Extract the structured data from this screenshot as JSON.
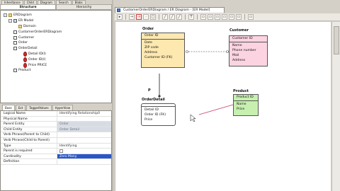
{
  "top_tabs": [
    "Inheritance",
    "Child",
    "Diagram",
    "Search",
    "Blobs"
  ],
  "panel_tabs": [
    "Structure",
    "Hierarchy"
  ],
  "tree": [
    {
      "indent": 0,
      "twist": "-",
      "icon": "folder",
      "label": "ERDiagram"
    },
    {
      "indent": 1,
      "twist": "-",
      "icon": "model",
      "label": "ER Model"
    },
    {
      "indent": 2,
      "twist": "none",
      "icon": "folder",
      "label": "Domain"
    },
    {
      "indent": 2,
      "twist": "none",
      "icon": "entity",
      "label": "CustomerOrderERDiagram"
    },
    {
      "indent": 2,
      "twist": "+",
      "icon": "entity",
      "label": "Customer"
    },
    {
      "indent": 2,
      "twist": "+",
      "icon": "entity",
      "label": "Order"
    },
    {
      "indent": 2,
      "twist": "-",
      "icon": "entity",
      "label": "OrderDetail"
    },
    {
      "indent": 3,
      "twist": "none",
      "icon": "attr",
      "label": "Detail ID(I)"
    },
    {
      "indent": 3,
      "twist": "none",
      "icon": "attr",
      "label": "Order ID(I)"
    },
    {
      "indent": 3,
      "twist": "none",
      "icon": "attr",
      "label": "Price PRICE"
    },
    {
      "indent": 2,
      "twist": "+",
      "icon": "entity",
      "label": "Product"
    }
  ],
  "prop_tabs": [
    "Base",
    "Ext",
    "TaggedValues",
    "HyperView"
  ],
  "properties": [
    {
      "key": "Logical Name",
      "value": "Identifying Relationship0",
      "style": ""
    },
    {
      "key": "Physical Name",
      "value": "",
      "style": ""
    },
    {
      "key": "Parent Entity",
      "value": "Order",
      "style": "dis"
    },
    {
      "key": "Child Entity",
      "value": "Order Detail",
      "style": "dis"
    },
    {
      "key": "Verb Phrase(Parent to Child)",
      "value": "",
      "style": ""
    },
    {
      "key": "Verb Phrase(Child to Parent)",
      "value": "",
      "style": ""
    },
    {
      "key": "Type",
      "value": "Identifying",
      "style": ""
    },
    {
      "key": "Parent is required",
      "value": "",
      "style": "chk"
    },
    {
      "key": "Cardinality",
      "value": "Zero Many",
      "style": "sel"
    },
    {
      "key": "Definition",
      "value": "",
      "style": ""
    }
  ],
  "document_tab": "CustomerOrderERDiagram / ER Diagram - [ER Model]",
  "toolbar_icons": [
    "select-icon",
    "sep",
    "arrow-icon",
    "relationship-icon",
    "pointer-icon",
    "entity-icon",
    "sep",
    "line-icon",
    "line-icon",
    "line-icon",
    "sep",
    "text-icon",
    "sep",
    "box-icon",
    "box-icon",
    "box-icon",
    "box-icon",
    "box-icon",
    "box-icon",
    "sep",
    "box-icon"
  ],
  "entities": {
    "order": {
      "title": "Order",
      "pk": "Order ID",
      "attrs": [
        "Date",
        "ZIP code",
        "Address",
        "Customer ID (FK)"
      ],
      "color": "#fde8b0"
    },
    "customer": {
      "title": "Customer",
      "pk": "Customer ID",
      "attrs": [
        "Name",
        "Phone number",
        "Mail",
        "Address"
      ],
      "color": "#fcd4e1"
    },
    "orderdetail": {
      "title": "OrderDetail",
      "pk": "",
      "attrs": [
        "Detail ID",
        "Order ID (FK)",
        "Price"
      ],
      "color": "#ffffff"
    },
    "product": {
      "title": "Product",
      "pk": "Product ID",
      "attrs": [
        "Name",
        "Price"
      ],
      "color": "#c7f0b0"
    }
  },
  "annotation_p": "P"
}
